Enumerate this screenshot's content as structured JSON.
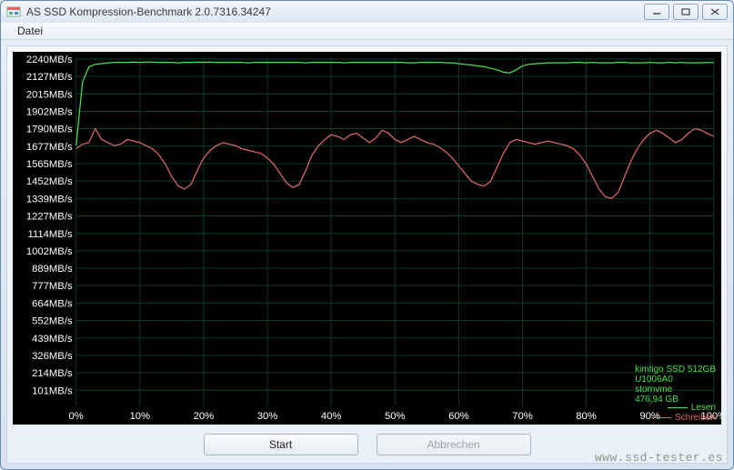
{
  "window": {
    "title": "AS SSD Kompression-Benchmark 2.0.7316.34247"
  },
  "menu": {
    "file": "Datei"
  },
  "buttons": {
    "start": "Start",
    "cancel": "Abbrechen"
  },
  "watermark": "www.ssd-tester.es",
  "drive_info": {
    "model": "kimtigo SSD 512GB",
    "firmware": "U1006A0",
    "driver": "stornvme",
    "capacity": "476,94 GB"
  },
  "legend": {
    "read": {
      "label": "Lesen",
      "color": "#4fe04f"
    },
    "write": {
      "label": "Schreiben",
      "color": "#e06a6a"
    }
  },
  "chart_data": {
    "type": "line",
    "title": "",
    "xlabel": "",
    "ylabel": "",
    "xlim": [
      0,
      100
    ],
    "ylim": [
      0,
      2250
    ],
    "y_ticks": [
      101,
      214,
      326,
      439,
      552,
      664,
      777,
      889,
      1002,
      1114,
      1227,
      1339,
      1452,
      1565,
      1677,
      1790,
      1902,
      2015,
      2127,
      2240
    ],
    "y_tick_unit": "MB/s",
    "x_ticks": [
      0,
      10,
      20,
      30,
      40,
      50,
      60,
      70,
      80,
      90,
      100
    ],
    "x_tick_unit": "%",
    "x": [
      0,
      1,
      2,
      3,
      4,
      5,
      6,
      7,
      8,
      9,
      10,
      11,
      12,
      13,
      14,
      15,
      16,
      17,
      18,
      19,
      20,
      21,
      22,
      23,
      24,
      25,
      26,
      27,
      28,
      29,
      30,
      31,
      32,
      33,
      34,
      35,
      36,
      37,
      38,
      39,
      40,
      41,
      42,
      43,
      44,
      45,
      46,
      47,
      48,
      49,
      50,
      51,
      52,
      53,
      54,
      55,
      56,
      57,
      58,
      59,
      60,
      61,
      62,
      63,
      64,
      65,
      66,
      67,
      68,
      69,
      70,
      71,
      72,
      73,
      74,
      75,
      76,
      77,
      78,
      79,
      80,
      81,
      82,
      83,
      84,
      85,
      86,
      87,
      88,
      89,
      90,
      91,
      92,
      93,
      94,
      95,
      96,
      97,
      98,
      99,
      100
    ],
    "series": [
      {
        "name": "Lesen",
        "color": "#4fe04f",
        "values": [
          1680,
          2090,
          2190,
          2205,
          2210,
          2215,
          2218,
          2218,
          2218,
          2220,
          2218,
          2220,
          2220,
          2218,
          2218,
          2218,
          2215,
          2218,
          2218,
          2220,
          2218,
          2220,
          2218,
          2218,
          2218,
          2218,
          2218,
          2215,
          2218,
          2218,
          2218,
          2218,
          2218,
          2218,
          2218,
          2218,
          2215,
          2218,
          2218,
          2218,
          2218,
          2218,
          2215,
          2218,
          2218,
          2218,
          2218,
          2218,
          2218,
          2218,
          2218,
          2218,
          2215,
          2215,
          2218,
          2218,
          2218,
          2218,
          2215,
          2215,
          2210,
          2205,
          2200,
          2195,
          2190,
          2180,
          2170,
          2155,
          2150,
          2170,
          2195,
          2205,
          2210,
          2212,
          2215,
          2215,
          2215,
          2215,
          2218,
          2218,
          2215,
          2218,
          2215,
          2215,
          2215,
          2218,
          2218,
          2215,
          2215,
          2215,
          2218,
          2215,
          2215,
          2218,
          2215,
          2218,
          2215,
          2215,
          2215,
          2218,
          2215
        ]
      },
      {
        "name": "Schreiben",
        "color": "#e06a6a",
        "values": [
          1660,
          1690,
          1700,
          1790,
          1720,
          1700,
          1680,
          1690,
          1720,
          1710,
          1700,
          1680,
          1660,
          1620,
          1560,
          1480,
          1420,
          1400,
          1430,
          1520,
          1600,
          1650,
          1680,
          1700,
          1690,
          1680,
          1660,
          1650,
          1640,
          1630,
          1600,
          1560,
          1500,
          1440,
          1410,
          1430,
          1520,
          1620,
          1680,
          1720,
          1750,
          1740,
          1720,
          1750,
          1760,
          1730,
          1700,
          1730,
          1780,
          1760,
          1720,
          1700,
          1720,
          1740,
          1720,
          1700,
          1690,
          1670,
          1640,
          1600,
          1550,
          1500,
          1450,
          1430,
          1420,
          1450,
          1540,
          1630,
          1700,
          1720,
          1710,
          1700,
          1690,
          1700,
          1710,
          1700,
          1690,
          1680,
          1660,
          1620,
          1560,
          1480,
          1400,
          1350,
          1340,
          1380,
          1480,
          1580,
          1660,
          1720,
          1760,
          1780,
          1760,
          1730,
          1700,
          1720,
          1760,
          1790,
          1780,
          1760,
          1740
        ]
      }
    ]
  }
}
